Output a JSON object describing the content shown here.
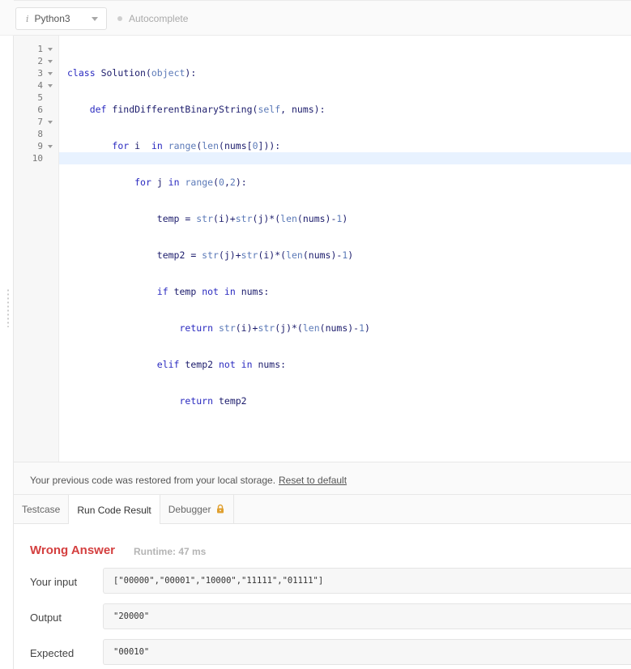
{
  "toolbar": {
    "language": "Python3",
    "autocomplete_label": "Autocomplete"
  },
  "editor": {
    "line_numbers": [
      "1",
      "2",
      "3",
      "4",
      "5",
      "6",
      "7",
      "8",
      "9",
      "10"
    ],
    "foldable_lines": [
      1,
      2,
      3,
      4,
      7,
      9
    ],
    "active_line": 10,
    "code_lines": [
      "class Solution(object):",
      "    def findDifferentBinaryString(self, nums):",
      "        for i  in range(len(nums[0])):",
      "            for j in range(0,2):",
      "                temp = str(i)+str(j)*(len(nums)-1)",
      "                temp2 = str(j)+str(i)*(len(nums)-1)",
      "                if temp not in nums:",
      "                    return str(i)+str(j)*(len(nums)-1)",
      "                elif temp2 not in nums:",
      "                    return temp2"
    ]
  },
  "restore": {
    "message": "Your previous code was restored from your local storage.",
    "reset_label": "Reset to default"
  },
  "tabs": [
    {
      "label": "Testcase",
      "active": false
    },
    {
      "label": "Run Code Result",
      "active": true
    },
    {
      "label": "Debugger",
      "active": false,
      "icon": "lock-icon"
    }
  ],
  "result": {
    "verdict": "Wrong Answer",
    "runtime": "Runtime: 47 ms",
    "input_label": "Your input",
    "input_value": "[\"00000\",\"00001\",\"10000\",\"11111\",\"01111\"]",
    "output_label": "Output",
    "output_value": "\"20000\"",
    "expected_label": "Expected",
    "expected_value": "\"00010\""
  },
  "colors": {
    "verdict": "#d43f3f",
    "keyword": "#2a2ac0",
    "builtin": "#5c7ab8",
    "active_line": "#e8f2ff",
    "lock": "#e0a030"
  }
}
